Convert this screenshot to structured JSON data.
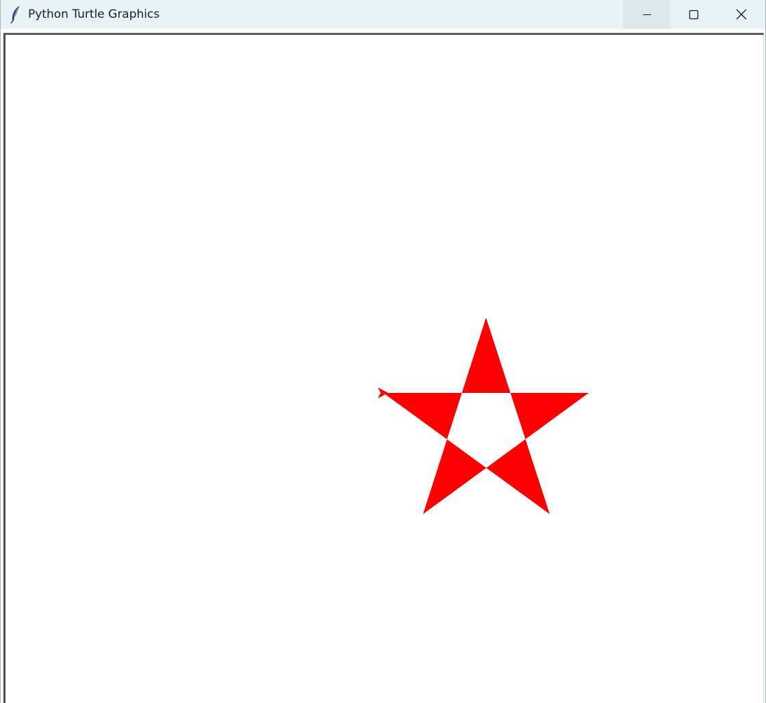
{
  "window": {
    "title": "Python Turtle Graphics",
    "icon": "feather-icon",
    "controls": {
      "minimize": "minimize-icon",
      "maximize": "maximize-icon",
      "close": "close-icon"
    }
  },
  "canvas": {
    "background": "#ffffff",
    "drawing": {
      "shape": "five-pointed star",
      "fill_color": "#ff0000",
      "turtle_color": "#ff0000",
      "turtle_heading": "east"
    }
  }
}
